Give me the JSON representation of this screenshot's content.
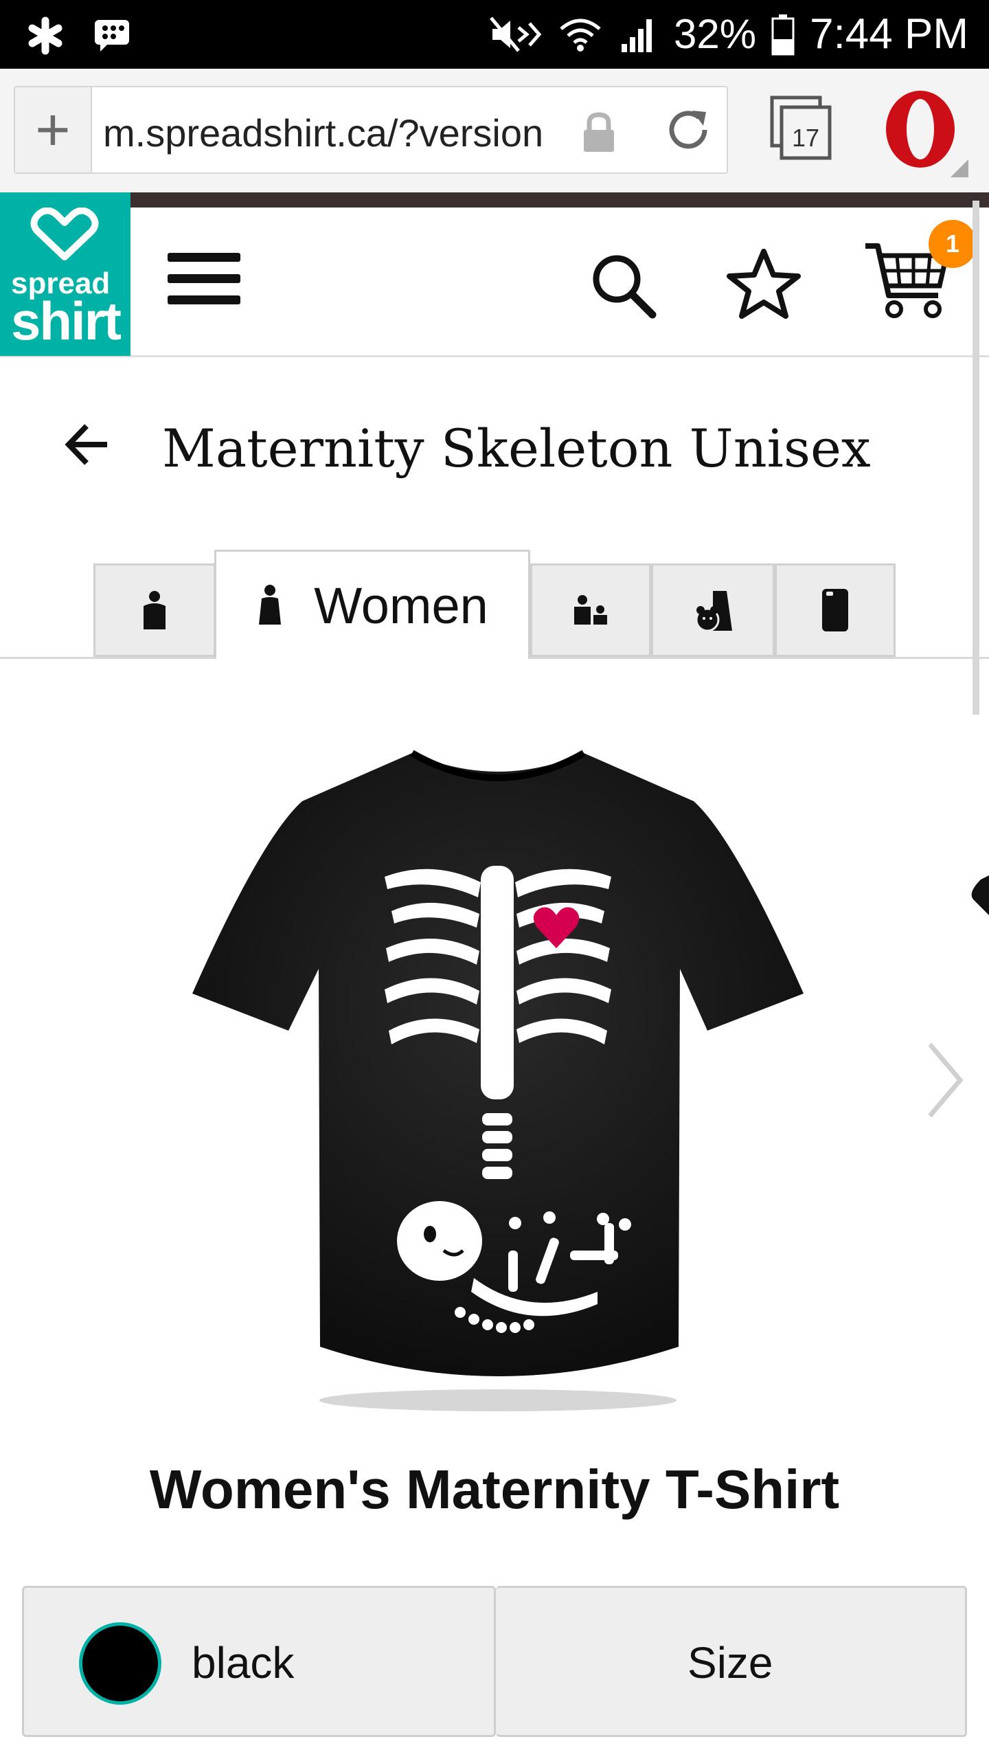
{
  "status_bar": {
    "battery": "32%",
    "time": "7:44 PM",
    "icons": [
      "asterisk-icon",
      "bbm-icon",
      "mute-icon",
      "wifi-icon",
      "signal-icon",
      "battery-icon"
    ]
  },
  "browser": {
    "url": "m.spreadshirt.ca/?version",
    "tab_count": "17",
    "icons": [
      "add-tab-icon",
      "lock-icon",
      "reload-icon",
      "tabs-icon",
      "opera-icon"
    ]
  },
  "site": {
    "logo_line1": "spread",
    "logo_line2": "shirt",
    "cart_count": "1",
    "brand_color": "#00b2a5",
    "badge_color": "#ff8a00"
  },
  "page": {
    "title": "Maternity Skeleton Unisex"
  },
  "category_tabs": [
    {
      "label": "",
      "icon": "men-icon"
    },
    {
      "label": "Women",
      "icon": "women-icon",
      "active": true
    },
    {
      "label": "",
      "icon": "kids-icon"
    },
    {
      "label": "",
      "icon": "baby-icon"
    },
    {
      "label": "",
      "icon": "phone-case-icon"
    }
  ],
  "product": {
    "name": "Women's Maternity T-Shirt",
    "color_label": "black",
    "size_label": "Size",
    "swatch_color": "#000000"
  }
}
